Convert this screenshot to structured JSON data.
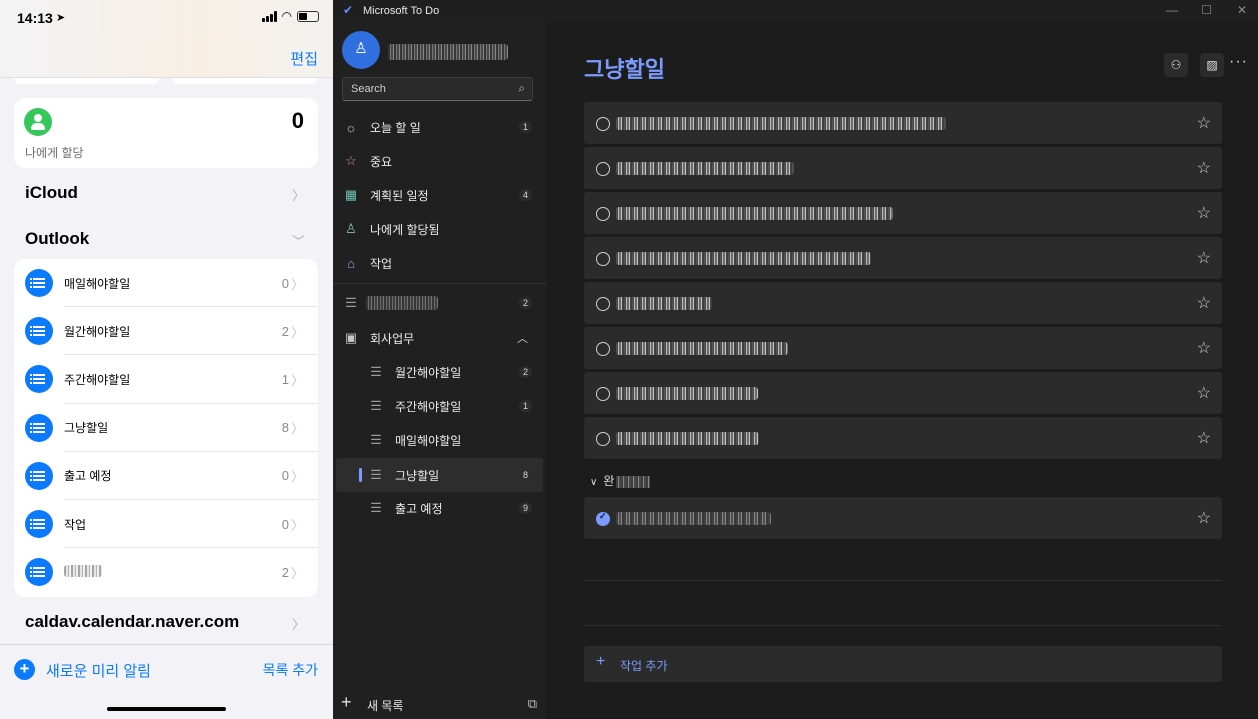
{
  "ios": {
    "status": {
      "time": "14:13"
    },
    "edit_label": "편집",
    "assigned": {
      "label": "나에게 할당",
      "count": "0"
    },
    "sections": {
      "icloud": "iCloud",
      "outlook": "Outlook",
      "caldav": "caldav.calendar.naver.com"
    },
    "lists": [
      {
        "name": "매일해야할일",
        "count": "0"
      },
      {
        "name": "월간해야할일",
        "count": "2"
      },
      {
        "name": "주간해야할일",
        "count": "1"
      },
      {
        "name": "그냥할일",
        "count": "8"
      },
      {
        "name": "출고 예정",
        "count": "0"
      },
      {
        "name": "작업",
        "count": "0"
      },
      {
        "name": "",
        "count": "2"
      }
    ],
    "footer": {
      "new_reminder": "새로운 미리 알림",
      "add_list": "목록 추가"
    }
  },
  "todo": {
    "window_title": "Microsoft To Do",
    "search_placeholder": "Search",
    "nav": [
      {
        "label": "오늘 할 일",
        "count": "1",
        "icon": "sun-icon"
      },
      {
        "label": "중요",
        "count": "",
        "icon": "star-icon"
      },
      {
        "label": "계획된 일정",
        "count": "4",
        "icon": "calendar-icon"
      },
      {
        "label": "나에게 할당됨",
        "count": "",
        "icon": "person-icon"
      },
      {
        "label": "작업",
        "count": "",
        "icon": "home-icon"
      }
    ],
    "blurred_list_count": "2",
    "group": {
      "label": "회사업무"
    },
    "group_lists": [
      {
        "label": "월간해야할일",
        "count": "2"
      },
      {
        "label": "주간해야할일",
        "count": "1"
      },
      {
        "label": "매일해야할일",
        "count": ""
      },
      {
        "label": "그냥할일",
        "count": "8"
      },
      {
        "label": "출고 예정",
        "count": "9"
      }
    ],
    "new_list_label": "새 목록",
    "main": {
      "title": "그냥할일",
      "completed_label": "완",
      "add_task_label": "작업 추가"
    },
    "colors": {
      "accent": "#7b9cff",
      "background": "#1c1c1c",
      "task_bg": "#2b2b2b"
    }
  }
}
